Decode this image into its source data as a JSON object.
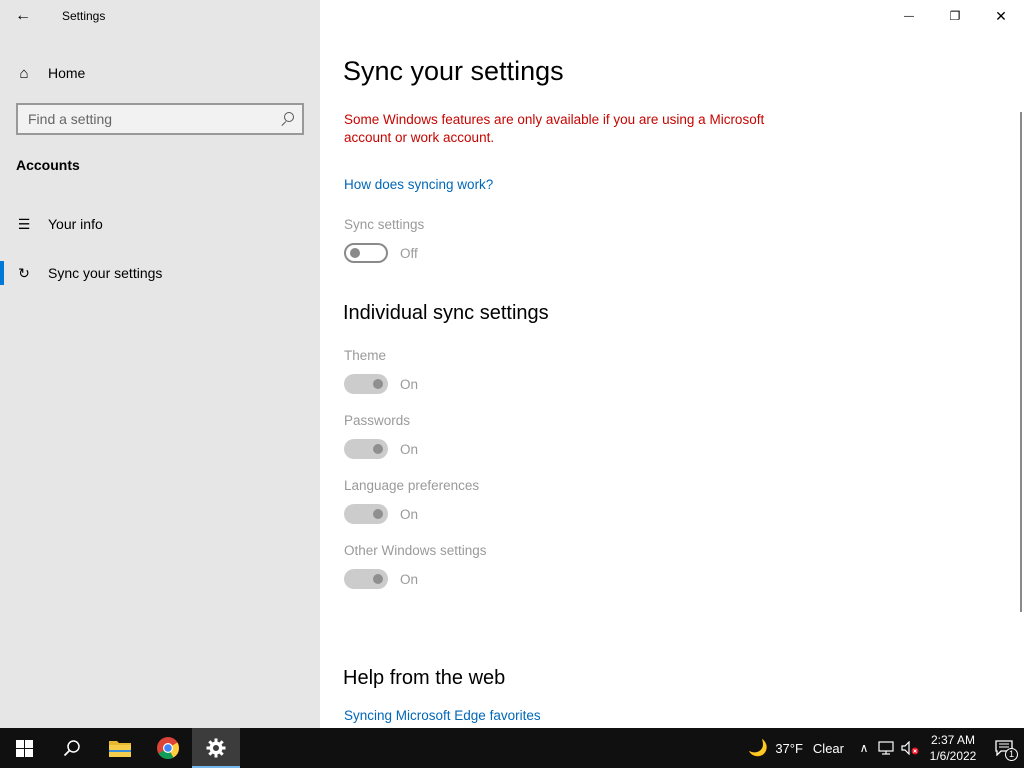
{
  "app": {
    "title": "Settings",
    "back_glyph": "←",
    "minimize_glyph": "—",
    "restore_glyph": "❐",
    "close_glyph": "✕"
  },
  "sidebar": {
    "home_label": "Home",
    "home_icon": "⌂",
    "search_placeholder": "Find a setting",
    "section": "Accounts",
    "items": [
      {
        "label": "Your info",
        "icon": "☰",
        "icon_name": "person-list-icon"
      },
      {
        "label": "Sync your settings",
        "icon": "↻",
        "icon_name": "sync-icon"
      }
    ]
  },
  "main": {
    "title": "Sync your settings",
    "warning": "Some Windows features are only available if you are using a Microsoft account or work account.",
    "how_link": "How does syncing work?",
    "sync_settings": {
      "label": "Sync settings",
      "state": "Off"
    },
    "individual_title": "Individual sync settings",
    "individual": [
      {
        "label": "Theme",
        "state": "On"
      },
      {
        "label": "Passwords",
        "state": "On"
      },
      {
        "label": "Language preferences",
        "state": "On"
      },
      {
        "label": "Other Windows settings",
        "state": "On"
      }
    ],
    "help_title": "Help from the web",
    "help_link": "Syncing Microsoft Edge favorites"
  },
  "taskbar": {
    "weather_icon": "🌙",
    "temperature": "37°F",
    "condition": "Clear",
    "chevron": "∧",
    "time": "2:37 AM",
    "date": "1/6/2022",
    "notification_count": "1"
  },
  "colors": {
    "accent": "#0078d7",
    "warning": "#c50500",
    "link": "#0067b8"
  }
}
